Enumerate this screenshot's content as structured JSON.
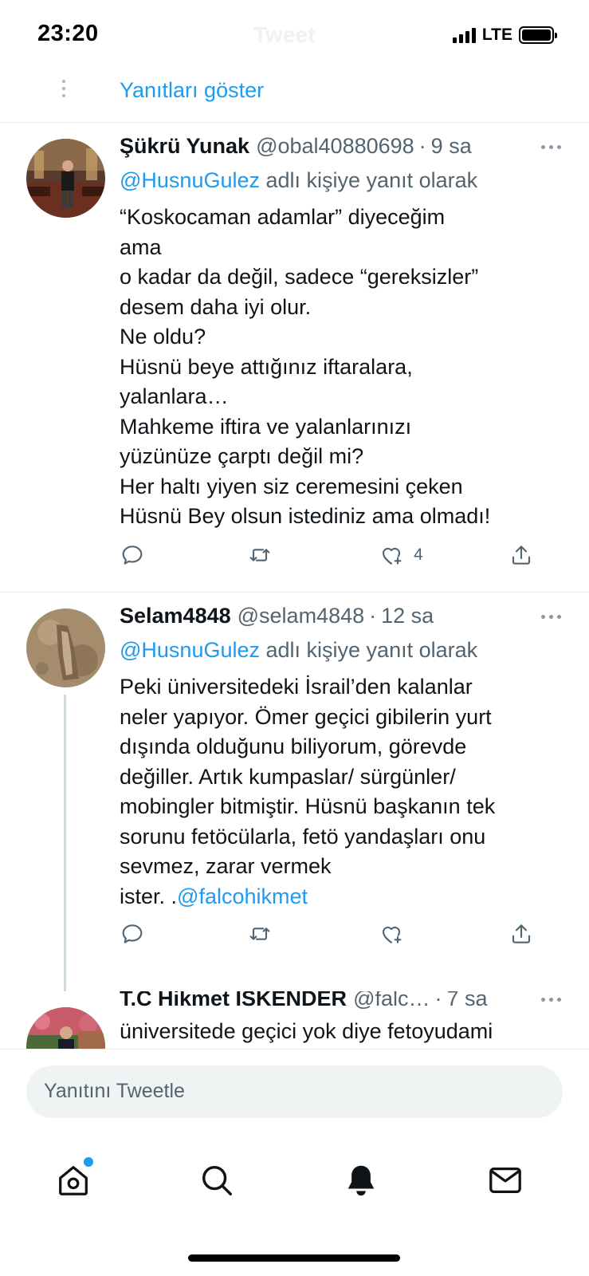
{
  "status_bar": {
    "time": "23:20",
    "ghost_title": "Tweet",
    "network": "LTE"
  },
  "show_replies": {
    "label": "Yanıtları göster"
  },
  "tweets": [
    {
      "name": "Şükrü Yunak",
      "handle": "@obal40880698",
      "time": "9 sa",
      "reply_mention": "@HusnuGulez",
      "reply_suffix": " adlı kişiye yanıt olarak",
      "lines": [
        "“Koskocaman adamlar” diyeceğim",
        "ama",
        "o kadar da değil, sadece “gereksizler”",
        "desem daha iyi olur.",
        "Ne oldu?",
        "Hüsnü beye attığınız iftaralara,",
        "yalanlara…",
        "Mahkeme iftira ve yalanlarınızı",
        "yüzünüze çarptı değil mi?",
        "Her haltı yiyen siz ceremesini çeken",
        "Hüsnü Bey olsun istediniz ama olmadı!"
      ],
      "like_count": "4"
    },
    {
      "name": "Selam4848",
      "handle": "@selam4848",
      "time": "12 sa",
      "reply_mention": "@HusnuGulez",
      "reply_suffix": " adlı kişiye yanıt olarak",
      "lines": [
        "Peki üniversitedeki İsrail’den kalanlar",
        "neler yapıyor. Ömer geçici gibilerin yurt",
        "dışında olduğunu biliyorum, görevde",
        "değiller. Artık kumpaslar/ sürgünler/",
        "mobingler bitmiştir. Hüsnü başkanın tek",
        "sorunu fetöcülarla, fetö yandaşları onu",
        "sevmez, zarar vermek"
      ],
      "last_line_prefix": "ister. .",
      "last_line_link": "@falcohikmet"
    },
    {
      "name": "T.C Hikmet İSKENDER",
      "handle": "@falc…",
      "time": "7 sa",
      "lines": [
        "üniversitede geçici yok diye fetoyudami"
      ]
    }
  ],
  "composer": {
    "placeholder": "Yanıtını Tweetle"
  },
  "icons": {
    "reply": "reply-icon",
    "retweet": "retweet-icon",
    "like": "like-icon",
    "share": "share-icon",
    "more": "more-icon",
    "home": "home-icon",
    "search": "search-icon",
    "notifications": "bell-icon",
    "messages": "mail-icon"
  },
  "colors": {
    "accent": "#1d9bf0",
    "text": "#0f1419",
    "secondary": "#536471",
    "divider": "#e6ecf0"
  }
}
